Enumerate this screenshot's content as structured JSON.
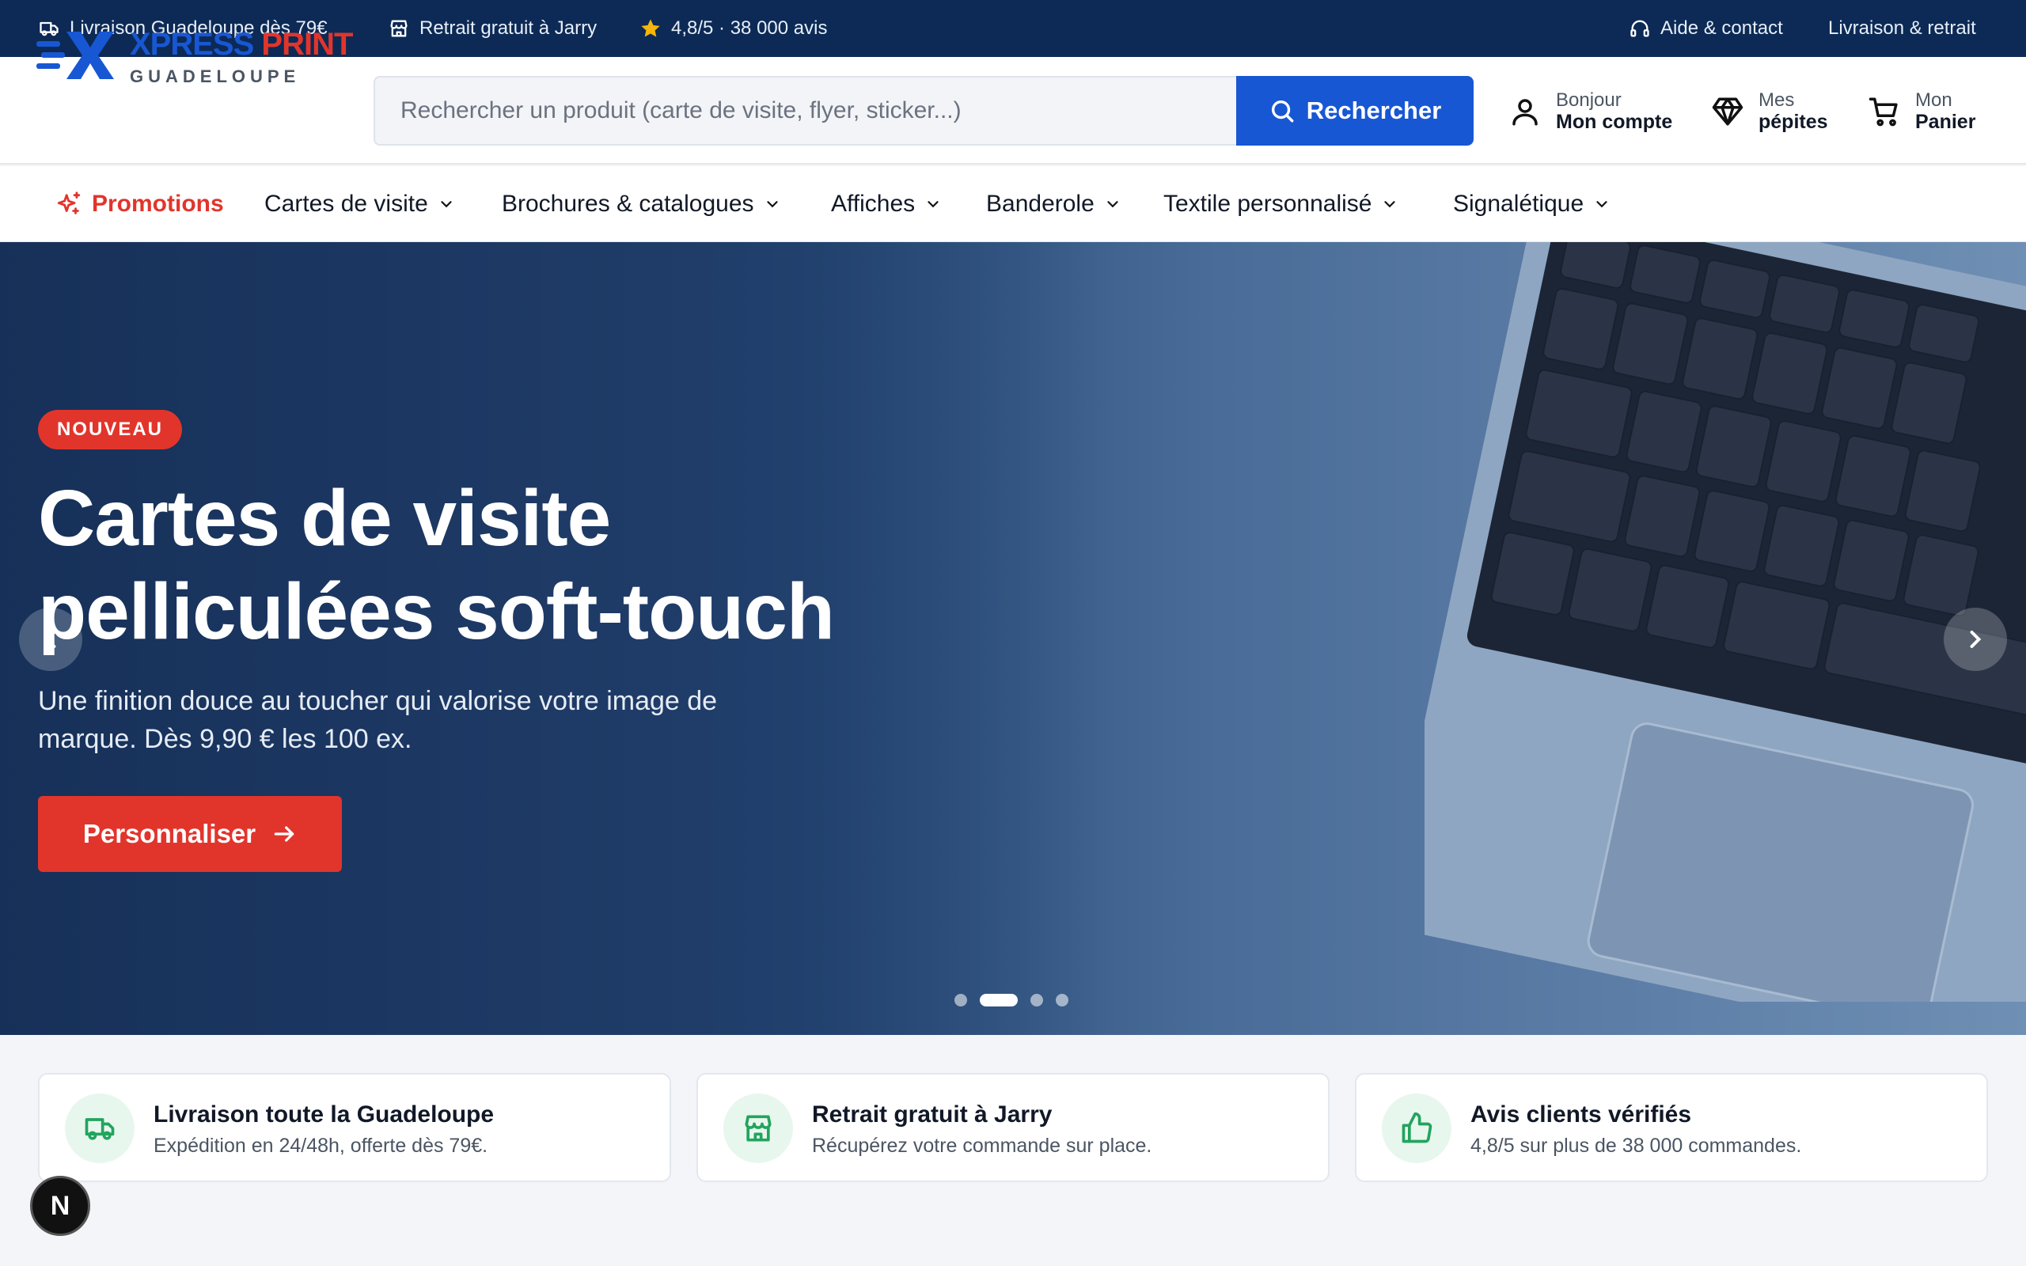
{
  "topbar": {
    "delivery": "Livraison Guadeloupe dès 79€",
    "pickup": "Retrait gratuit à Jarry",
    "rating": "4,8/5 · 38 000 avis",
    "help": "Aide & contact",
    "shipping": "Livraison & retrait"
  },
  "logo": {
    "part1": "XPRESS",
    "part2": "PRINT",
    "sub": "GUADELOUPE"
  },
  "search": {
    "placeholder": "Rechercher un produit (carte de visite, flyer, sticker...)",
    "button": "Rechercher"
  },
  "account": {
    "line1": "Bonjour",
    "line2": "Mon compte"
  },
  "nuggets": {
    "line1": "Mes",
    "line2": "pépites"
  },
  "cart": {
    "line1": "Mon",
    "line2": "Panier"
  },
  "nav": {
    "promo": "Promotions",
    "items": [
      "Cartes de visite",
      "Brochures & catalogues",
      "Affiches",
      "Banderole",
      "Textile personnalisé",
      "Signalétique"
    ]
  },
  "hero": {
    "badge": "NOUVEAU",
    "title": "Cartes de visite pelliculées soft-touch",
    "subtitle": "Une finition douce au toucher qui valorise votre image de marque. Dès 9,90 € les 100 ex.",
    "cta": "Personnaliser",
    "slides": 4,
    "active_slide": 2
  },
  "features": [
    {
      "title": "Livraison toute la Guadeloupe",
      "subtitle": "Expédition en 24/48h, offerte dès 79€.",
      "icon": "truck-icon"
    },
    {
      "title": "Retrait gratuit à Jarry",
      "subtitle": "Récupérez votre commande sur place.",
      "icon": "store-icon"
    },
    {
      "title": "Avis clients vérifiés",
      "subtitle": "4,8/5 sur plus de 38 000 commandes.",
      "icon": "thumbs-up-icon"
    }
  ],
  "dev_badge": "N",
  "colors": {
    "navy": "#0c2a55",
    "brand_blue": "#1857d4",
    "brand_red": "#e1352c",
    "feature_green": "#22a45d"
  }
}
